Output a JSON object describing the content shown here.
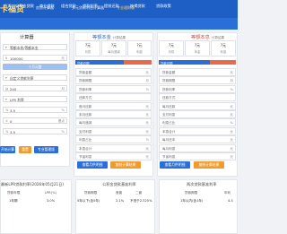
{
  "colors": {
    "brand": "#1d5fc4",
    "nav": "#2a6ed8",
    "accent": "#ffd76a",
    "btn_orange": "#f19b2c",
    "btn_blue": "#2a6ed8",
    "bar_blue": "#2a6ed8",
    "bar_red": "#e86a4e"
  },
  "header": {
    "logo": "卡福贷",
    "crumbs": [
      "房贷计算器",
      "·",
      "多元贷款利息计算器",
      "专业理财版"
    ]
  },
  "nav": [
    "首页",
    "公积金贷款",
    "商业贷款",
    "组合贷款",
    "贷款利率",
    "提前还款",
    "按揭贷款",
    "贷款政策"
  ],
  "calculator": {
    "title": "计算器",
    "fields": [
      {
        "label": "贷款类型",
        "value": "等额本息/等额本金",
        "unit": ""
      },
      {
        "label": "贷款金额",
        "value": "100000",
        "unit": "元"
      },
      {
        "label": "",
        "value": "十万元整",
        "unit": ""
      },
      {
        "label": "利率",
        "value": "自定义贷款利率",
        "unit": ""
      },
      {
        "label": "年限",
        "value": "240",
        "unit": "月"
      },
      {
        "label": "",
        "value": "LPR 利率",
        "unit": ""
      },
      {
        "label": "",
        "value": "3.5",
        "unit": "%"
      },
      {
        "label": "",
        "value": "0",
        "unit": "基点"
      },
      {
        "label": "",
        "value": "3.5",
        "unit": "%"
      }
    ],
    "buttons": {
      "start": "开始计算",
      "reset": "重置",
      "pro": "专业管理版"
    }
  },
  "equal_payment": {
    "title": "等额本金",
    "subtitle": "计算结果",
    "summary": [
      {
        "top": "?元",
        "bottom": "月供"
      },
      {
        "top": "?元",
        "bottom": "每月递减"
      },
      {
        "top": "?元",
        "bottom": "利息"
      }
    ],
    "bar_label": "贷款总额",
    "rows": [
      {
        "label": "贷款金额",
        "unit": "元"
      },
      {
        "label": "贷款期限",
        "unit": "月"
      },
      {
        "label": "贷款利率",
        "unit": "%"
      },
      {
        "label": "还款方式",
        "unit": ""
      },
      {
        "label": "首月还款",
        "unit": "元"
      },
      {
        "label": "末月还款",
        "unit": "元"
      },
      {
        "label": "每月递减",
        "unit": "元"
      },
      {
        "label": "支付利息",
        "unit": "元"
      },
      {
        "label": "利息占比",
        "unit": "%"
      },
      {
        "label": "本息合计",
        "unit": "元"
      },
      {
        "label": "节省利息",
        "unit": "元"
      }
    ],
    "buttons": {
      "plan": "查看月供明细",
      "copy": "复制计算结果"
    }
  },
  "equal_principal": {
    "title": "等额本息",
    "subtitle": "计算结果",
    "summary": [
      {
        "top": "?元",
        "bottom": "月供"
      },
      {
        "top": "?元",
        "bottom": "本金"
      },
      {
        "top": "?元",
        "bottom": "利息"
      }
    ],
    "bar_label": "贷款总额",
    "rows": [
      {
        "label": "贷款金额",
        "unit": "元"
      },
      {
        "label": "贷款期限",
        "unit": "月"
      },
      {
        "label": "贷款利率",
        "unit": "%"
      },
      {
        "label": "还款方式",
        "unit": ""
      },
      {
        "label": "每月还款",
        "unit": "元"
      },
      {
        "label": "支付利息",
        "unit": "元"
      },
      {
        "label": "利息占比",
        "unit": "%"
      },
      {
        "label": "本息合计",
        "unit": "元"
      },
      {
        "label": "每月还本",
        "unit": "元"
      },
      {
        "label": "每月利息",
        "unit": "元"
      },
      {
        "label": "节省利息",
        "unit": "元"
      }
    ],
    "buttons": {
      "plan": "查看月供明细",
      "copy": "复制计算结果"
    }
  },
  "bottom": {
    "lpr": {
      "title": "最新LPR贷款利率(2026年05月21日)",
      "headers": [
        "贷款年限",
        "LPR(%)"
      ],
      "rows": [
        [
          "1年期",
          "3.0%"
        ]
      ]
    },
    "pf": {
      "title": "公积金贷款基准利率",
      "headers": [
        "贷款期限",
        "首套",
        "二套"
      ],
      "rows": [
        [
          "5年以下(含5年)",
          "2.1%",
          "不低于2.525%"
        ]
      ]
    },
    "biz": {
      "title": "两次贷款基准利率",
      "headers": [
        "贷款期限",
        "年利"
      ],
      "rows": [
        [
          "1年以内(含1年)",
          "4.3"
        ]
      ]
    }
  }
}
